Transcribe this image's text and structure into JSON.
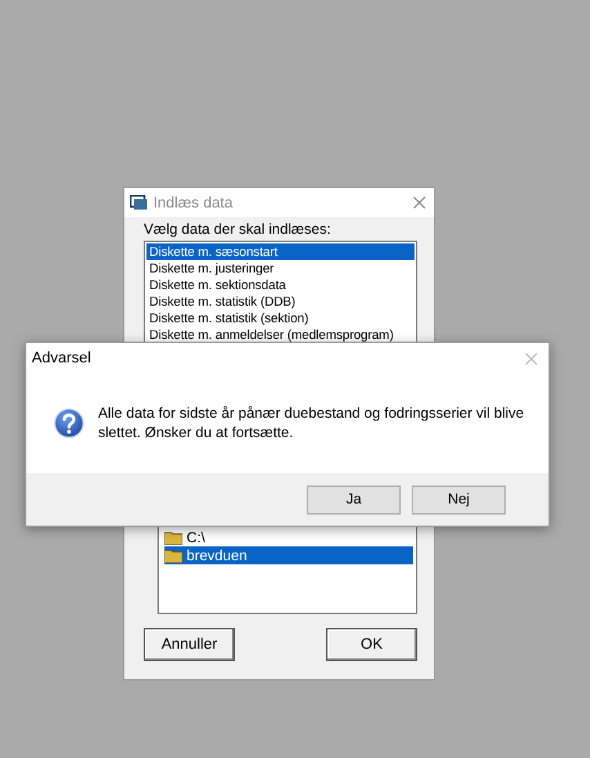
{
  "load_dialog": {
    "title": "Indlæs data",
    "prompt": "Vælg data der skal indlæses:",
    "data_items": [
      {
        "label": "Diskette m. sæsonstart",
        "selected": true
      },
      {
        "label": "Diskette m. justeringer",
        "selected": false
      },
      {
        "label": "Diskette m. sektionsdata",
        "selected": false
      },
      {
        "label": "Diskette m. statistik (DDB)",
        "selected": false
      },
      {
        "label": "Diskette m. statistik (sektion)",
        "selected": false
      },
      {
        "label": "Diskette m. anmeldelser (medlemsprogram)",
        "selected": false
      }
    ],
    "folders": [
      {
        "label": "C:\\",
        "selected": false
      },
      {
        "label": "brevduen",
        "selected": true
      }
    ],
    "buttons": [
      "Annuller",
      "OK"
    ]
  },
  "warning_dialog": {
    "title": "Advarsel",
    "message": "Alle data for sidste år pånær duebestand og fodringsserier vil blive slettet. Ønsker du at fortsætte.",
    "buttons": [
      "Ja",
      "Nej"
    ]
  }
}
